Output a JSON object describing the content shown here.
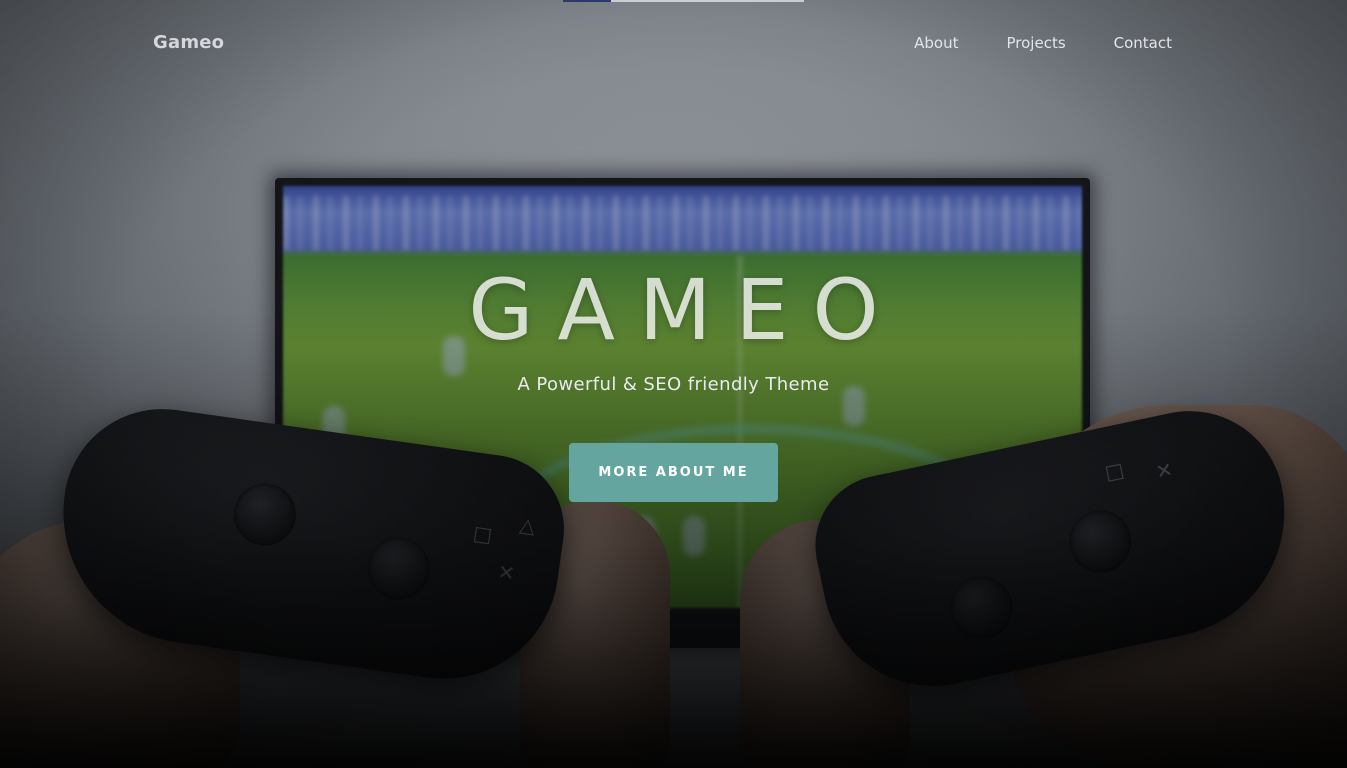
{
  "nav": {
    "brand": "Gameo",
    "links": [
      {
        "label": "About"
      },
      {
        "label": "Projects"
      },
      {
        "label": "Contact"
      }
    ]
  },
  "hero": {
    "title": "GAMEO",
    "subtitle": "A Powerful & SEO friendly Theme",
    "cta_label": "MORE ABOUT ME"
  },
  "colors": {
    "accent": "#64a69f",
    "nav_text": "#e2e5e8",
    "background_dark": "#0b0b0d"
  },
  "background": {
    "scene": "tv-with-game-controllers-photo"
  },
  "icons": {
    "controller_buttons": [
      "triangle-icon",
      "square-icon",
      "cross-icon",
      "circle-icon"
    ]
  }
}
